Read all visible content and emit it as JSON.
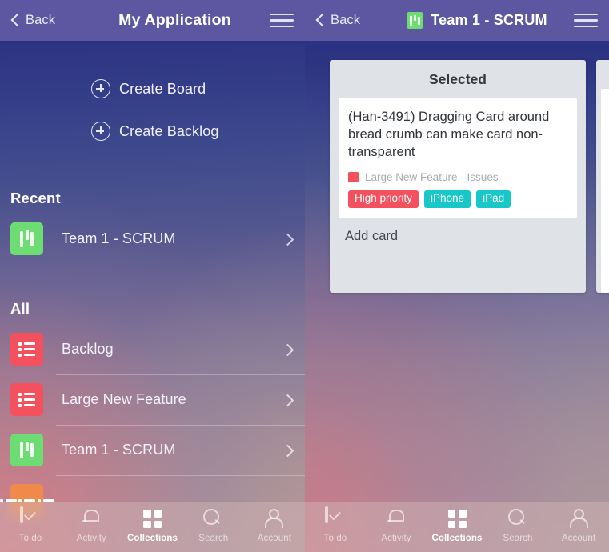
{
  "left_panel": {
    "header": {
      "back_label": "Back",
      "title": "My Application",
      "menu_icon": "hamburger-icon"
    },
    "actions": [
      {
        "label": "Create Board",
        "icon": "plus-circle-icon"
      },
      {
        "label": "Create Backlog",
        "icon": "plus-circle-icon"
      }
    ],
    "sections": [
      {
        "title": "Recent",
        "items": [
          {
            "label": "Team 1 - SCRUM",
            "icon": "board-icon",
            "icon_color": "#6ddc72",
            "chevron": "chevron-right-icon"
          }
        ]
      },
      {
        "title": "All",
        "items": [
          {
            "label": "Backlog",
            "icon": "backlog-icon",
            "icon_color": "#f4515f",
            "chevron": "chevron-right-icon"
          },
          {
            "label": "Large New Feature",
            "icon": "backlog-icon",
            "icon_color": "#f4515f",
            "chevron": "chevron-right-icon"
          },
          {
            "label": "Team 1 - SCRUM",
            "icon": "board-icon",
            "icon_color": "#6ddc72",
            "chevron": "chevron-right-icon"
          },
          {
            "label": "",
            "icon": "backlog-icon",
            "icon_color": "#f08a4b",
            "chevron": "chevron-right-icon"
          }
        ]
      }
    ]
  },
  "right_panel": {
    "header": {
      "back_label": "Back",
      "title": "Team 1 - SCRUM",
      "board_chip_color": "#6ddc72",
      "menu_icon": "hamburger-icon"
    },
    "board": {
      "columns": [
        {
          "title": "Selected",
          "cards": [
            {
              "title": "(Han-3491) Dragging Card around bread crumb can make card non-transparent",
              "origin": "Large New Feature - Issues",
              "origin_color": "#f4515f",
              "tags": [
                {
                  "label": "High priority",
                  "color": "#f4515f"
                },
                {
                  "label": "iPhone",
                  "color": "#18c8c8"
                },
                {
                  "label": "iPad",
                  "color": "#18c8c8"
                }
              ]
            }
          ],
          "add_card_label": "Add card"
        }
      ]
    }
  },
  "tabbar": {
    "tabs": [
      {
        "label": "To do",
        "icon": "checkbox-icon",
        "active": false
      },
      {
        "label": "Activity",
        "icon": "bell-icon",
        "active": false
      },
      {
        "label": "Collections",
        "icon": "grid-icon",
        "active": true
      },
      {
        "label": "Search",
        "icon": "search-icon",
        "active": false
      },
      {
        "label": "Account",
        "icon": "person-icon",
        "active": false
      }
    ]
  },
  "theme": {
    "header_bg": "#5c57a0",
    "header_strip": "#2b3387",
    "column_bg": "#dfe3e8",
    "card_bg": "#ffffff",
    "accent_red": "#f4515f",
    "accent_teal": "#18c8c8",
    "accent_green": "#6ddc72",
    "accent_orange": "#f08a4b"
  }
}
